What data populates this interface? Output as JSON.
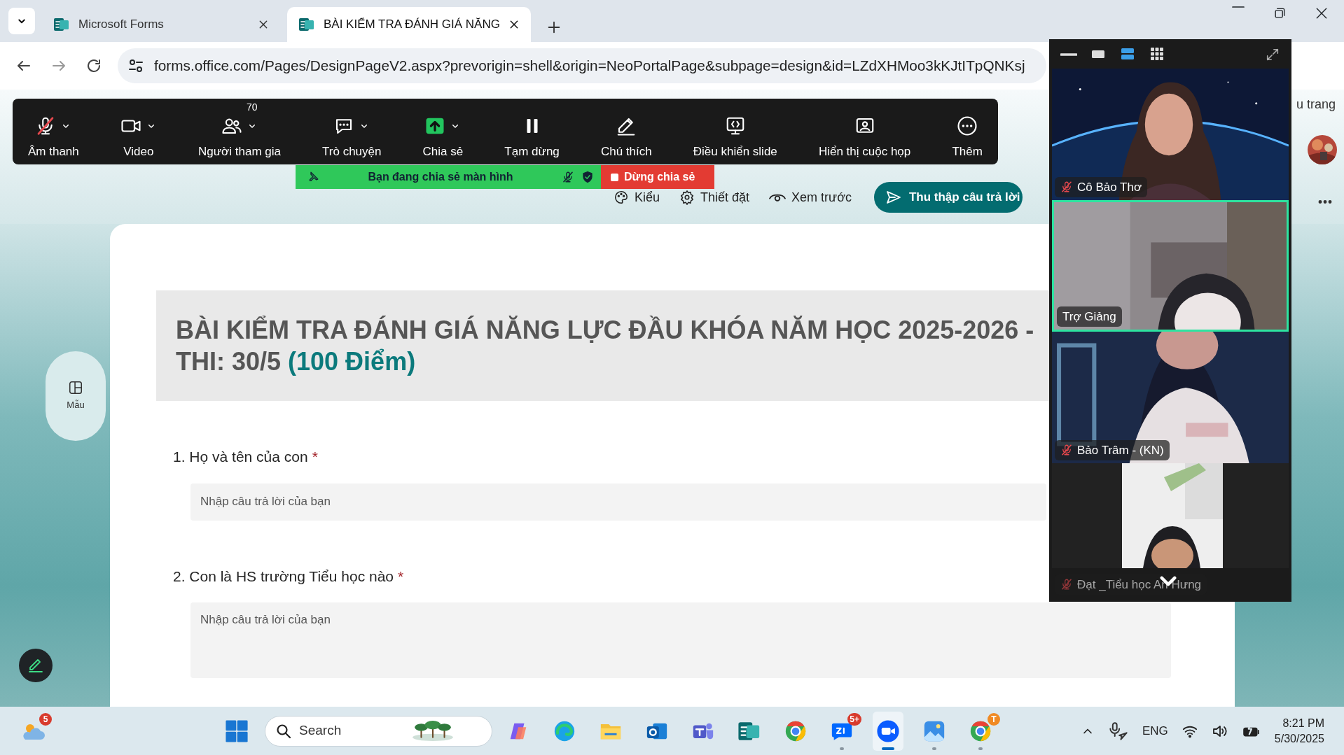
{
  "browser": {
    "tabs": [
      {
        "title": "Microsoft Forms",
        "selected": false
      },
      {
        "title": "BÀI KIỂM TRA ĐÁNH GIÁ NĂNG",
        "selected": true
      }
    ],
    "url": "forms.office.com/Pages/DesignPageV2.aspx?prevorigin=shell&origin=NeoPortalPage&subpage=design&id=LZdXHMoo3kKJtITpQNKsj"
  },
  "zoom_toolbar": {
    "items": [
      {
        "kind": "audio",
        "label": "Âm thanh",
        "muted": true,
        "menu": true
      },
      {
        "kind": "video",
        "label": "Video",
        "menu": true
      },
      {
        "kind": "participants",
        "label": "Người tham gia",
        "count": "70",
        "menu": true
      },
      {
        "kind": "chat",
        "label": "Trò chuyện",
        "menu": true
      },
      {
        "kind": "share",
        "label": "Chia sẻ",
        "menu": true
      },
      {
        "kind": "pause",
        "label": "Tạm dừng",
        "menu": false
      },
      {
        "kind": "annotate",
        "label": "Chú thích",
        "menu": false
      },
      {
        "kind": "slides",
        "label": "Điều khiển slide",
        "menu": false
      },
      {
        "kind": "view",
        "label": "Hiển thị cuộc họp",
        "menu": false
      },
      {
        "kind": "more",
        "label": "Thêm",
        "menu": false
      }
    ]
  },
  "share_banner": {
    "text": "Bạn đang chia sẻ màn hình",
    "stop": "Dừng chia sẻ"
  },
  "forms_header": {
    "partial_label": "u trang",
    "commands": [
      {
        "kind": "style",
        "label": "Kiểu"
      },
      {
        "kind": "settings",
        "label": "Thiết đặt"
      },
      {
        "kind": "preview",
        "label": "Xem trước"
      }
    ],
    "collect_button": "Thu thập câu trả lời"
  },
  "side_panel": {
    "template_label": "Mẫu"
  },
  "form": {
    "title_line1": "BÀI KIỂM TRA ĐÁNH GIÁ NĂNG LỰC ĐẦU KHÓA NĂM HỌC 2025-2026 -",
    "title_line2": "THI: 30/5",
    "points": "(100 Điểm)",
    "questions": [
      {
        "number": "1.",
        "text": "Họ và tên của con",
        "required": true,
        "required_mark": "*",
        "kind": "short",
        "placeholder": "Nhập câu trả lời của bạn"
      },
      {
        "number": "2.",
        "text": "Con là HS trường Tiểu học nào",
        "required": true,
        "required_mark": "*",
        "kind": "long",
        "placeholder": "Nhập câu trả lời của bạn"
      }
    ]
  },
  "video_panel": {
    "view_modes": [
      {
        "kind": "minimize",
        "selected": false
      },
      {
        "kind": "single",
        "selected": false
      },
      {
        "kind": "speaker",
        "selected": true
      },
      {
        "kind": "gallery",
        "selected": false
      }
    ],
    "tiles": [
      {
        "name": "Cô Bảo Thơ",
        "muted": true,
        "speaking": false,
        "dimmed": false,
        "kind": "space"
      },
      {
        "name": "Trợ Giảng",
        "muted": false,
        "speaking": true,
        "dimmed": false,
        "kind": "room"
      },
      {
        "name": "Bảo Trâm - (KN)",
        "muted": true,
        "speaking": false,
        "dimmed": false,
        "kind": "shirt"
      },
      {
        "name": "Đạt _Tiểu học An Hưng",
        "muted": true,
        "speaking": false,
        "dimmed": true,
        "kind": "small"
      }
    ]
  },
  "taskbar": {
    "weather_badge": "5",
    "search": {
      "placeholder": "Search"
    },
    "apps": [
      {
        "kind": "copilot",
        "running": false,
        "active": false
      },
      {
        "kind": "edge",
        "running": false,
        "active": false
      },
      {
        "kind": "files",
        "running": false,
        "active": false
      },
      {
        "kind": "outlook",
        "running": false,
        "active": false
      },
      {
        "kind": "teams",
        "running": false,
        "active": false
      },
      {
        "kind": "forms",
        "running": false,
        "active": false
      },
      {
        "kind": "chrome",
        "running": false,
        "active": false
      },
      {
        "kind": "zalo",
        "running": true,
        "active": false,
        "badge": "5+"
      },
      {
        "kind": "zoom",
        "running": true,
        "active": true
      },
      {
        "kind": "photos",
        "running": true,
        "active": false
      },
      {
        "kind": "chrome",
        "running": true,
        "active": false,
        "badge": "T"
      }
    ],
    "language": "ENG",
    "time": "8:21 PM",
    "date": "5/30/2025"
  }
}
